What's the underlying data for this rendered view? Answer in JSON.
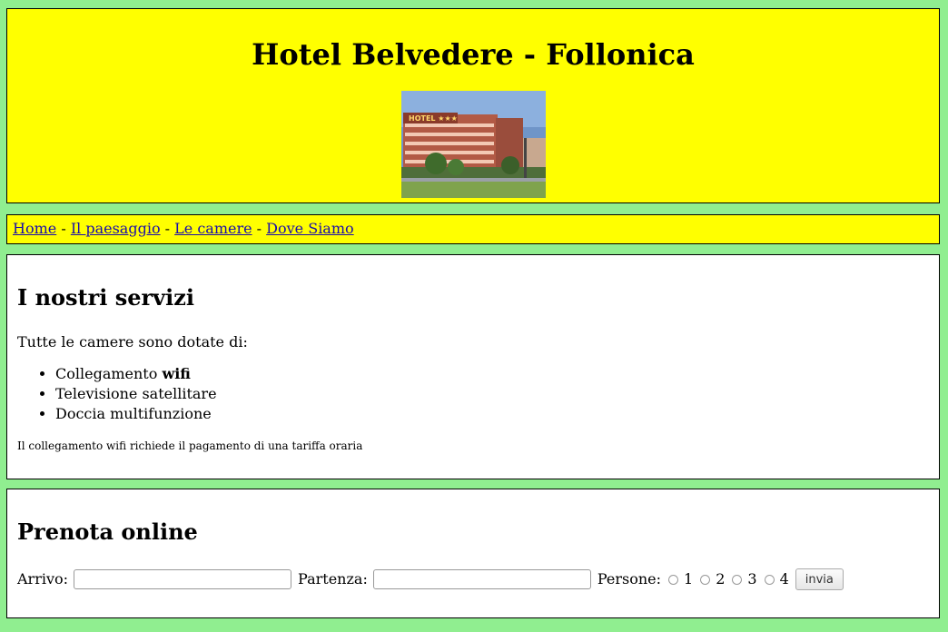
{
  "header": {
    "title": "Hotel Belvedere - Follonica",
    "photo_sign": "HOTEL ★★★"
  },
  "nav": {
    "items": [
      "Home",
      "Il paesaggio",
      "Le camere",
      "Dove Siamo"
    ],
    "separator": " - "
  },
  "services": {
    "title": "I nostri servizi",
    "intro": "Tutte le camere sono dotate di:",
    "list": [
      {
        "text": "Collegamento ",
        "bold": "wifi"
      },
      {
        "text": "Televisione satellitare"
      },
      {
        "text": "Doccia multifunzione"
      }
    ],
    "note": "Il collegamento wifi richiede il pagamento di una tariffa oraria"
  },
  "booking": {
    "title": "Prenota online",
    "arrival_label": "Arrivo:",
    "arrival_value": "",
    "departure_label": "Partenza:",
    "departure_value": "",
    "persons_label": "Persone:",
    "persons_options": [
      "1",
      "2",
      "3",
      "4"
    ],
    "submit_label": "invia"
  },
  "colors": {
    "page_bg": "#90ee90",
    "panel_yellow": "#ffff00",
    "link": "#1a0dab"
  }
}
